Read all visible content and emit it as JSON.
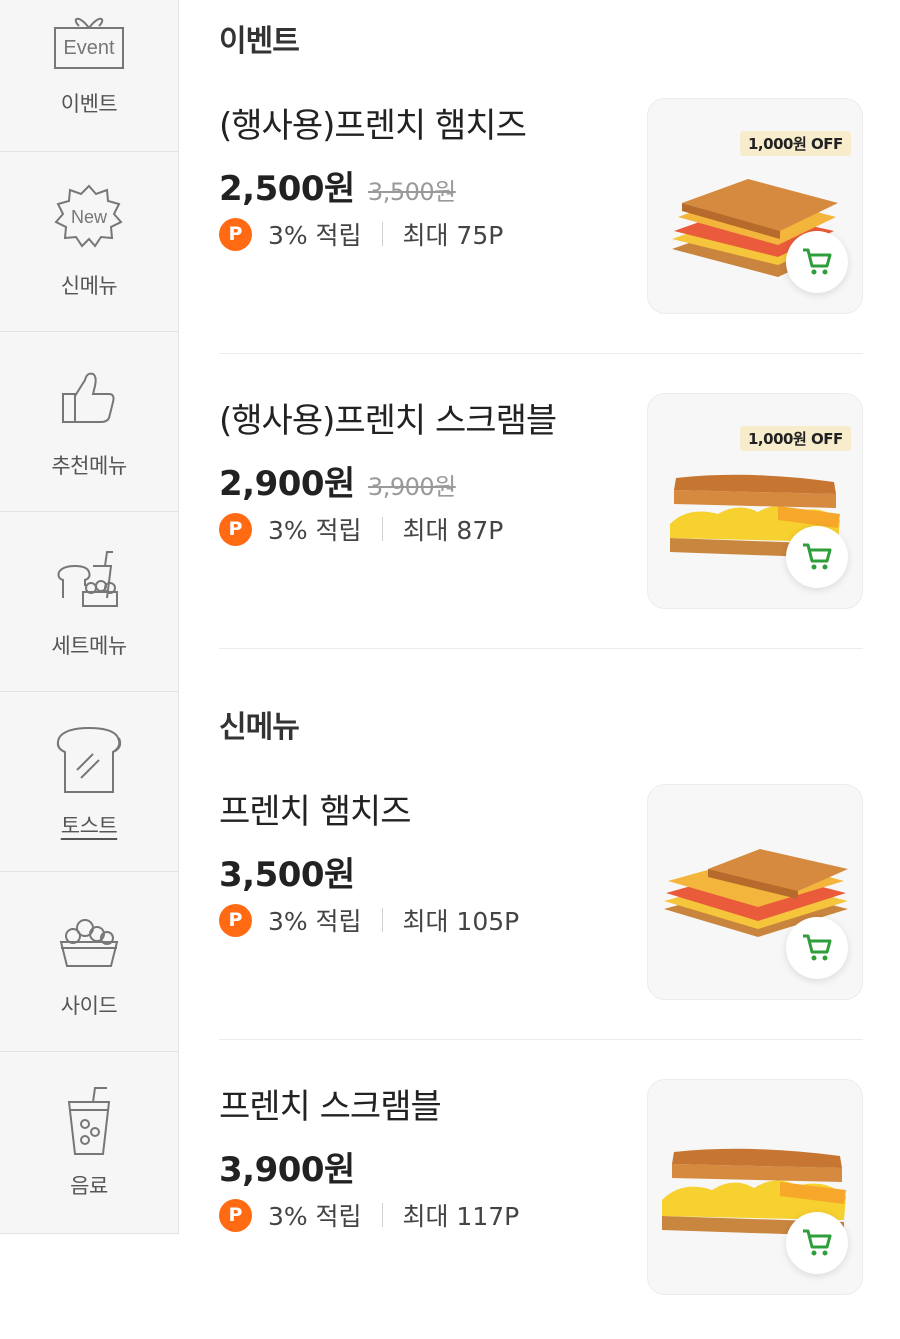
{
  "sidebar": {
    "items": [
      {
        "label": "이벤트",
        "icon": "event-gift-icon",
        "badge_text": "Event"
      },
      {
        "label": "신메뉴",
        "icon": "new-badge-icon",
        "badge_text": "New"
      },
      {
        "label": "추천메뉴",
        "icon": "thumbs-up-icon"
      },
      {
        "label": "세트메뉴",
        "icon": "set-menu-icon"
      },
      {
        "label": "토스트",
        "icon": "toast-icon"
      },
      {
        "label": "사이드",
        "icon": "side-basket-icon"
      },
      {
        "label": "음료",
        "icon": "drink-cup-icon"
      }
    ],
    "active_index": 4
  },
  "sections": [
    {
      "title": "이벤트",
      "items": [
        {
          "name": "(행사용)프렌치 햄치즈",
          "price": "2,500원",
          "original_price": "3,500원",
          "point_rate": "3% 적립",
          "point_max": "최대 75P",
          "badge": "1,000원 OFF"
        },
        {
          "name": "(행사용)프렌치 스크램블",
          "price": "2,900원",
          "original_price": "3,900원",
          "point_rate": "3% 적립",
          "point_max": "최대 87P",
          "badge": "1,000원 OFF"
        }
      ]
    },
    {
      "title": "신메뉴",
      "items": [
        {
          "name": "프렌치 햄치즈",
          "price": "3,500원",
          "point_rate": "3% 적립",
          "point_max": "최대 105P"
        },
        {
          "name": "프렌치 스크램블",
          "price": "3,900원",
          "point_rate": "3% 적립",
          "point_max": "최대 117P"
        }
      ]
    }
  ],
  "point_badge_letter": "P",
  "colors": {
    "point_orange": "#ff6a13",
    "cart_green": "#2e9e3a",
    "off_badge_bg": "#f7edcd"
  }
}
